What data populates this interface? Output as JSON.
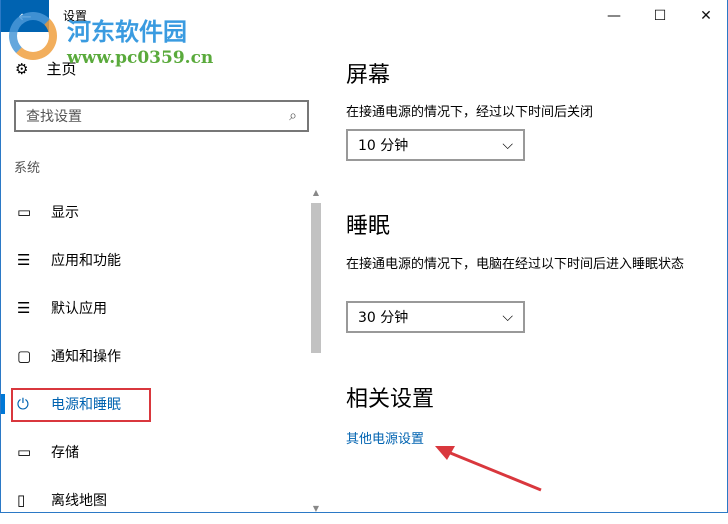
{
  "window": {
    "title": "设置",
    "back": "←",
    "minimize": "—",
    "maximize": "☐",
    "close": "✕"
  },
  "watermark": {
    "name": "河东软件园",
    "url": "www.pc0359.cn"
  },
  "sidebar": {
    "home": "主页",
    "search_placeholder": "查找设置",
    "section": "系统",
    "items": [
      {
        "icon": "▭",
        "label": "显示"
      },
      {
        "icon": "☰",
        "label": "应用和功能"
      },
      {
        "icon": "☰",
        "label": "默认应用"
      },
      {
        "icon": "▢",
        "label": "通知和操作"
      },
      {
        "icon": "⏻",
        "label": "电源和睡眠"
      },
      {
        "icon": "▭",
        "label": "存储"
      },
      {
        "icon": "▯",
        "label": "离线地图"
      }
    ]
  },
  "main": {
    "screen": {
      "title": "屏幕",
      "desc": "在接通电源的情况下，经过以下时间后关闭",
      "value": "10 分钟"
    },
    "sleep": {
      "title": "睡眠",
      "desc": "在接通电源的情况下，电脑在经过以下时间后进入睡眠状态",
      "value": "30 分钟"
    },
    "related": {
      "title": "相关设置",
      "link": "其他电源设置"
    }
  },
  "colors": {
    "accent": "#0063b1",
    "highlight": "#d9373d"
  }
}
